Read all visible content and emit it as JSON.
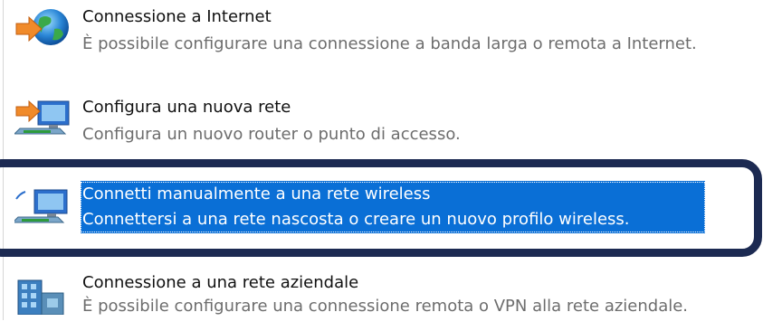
{
  "options": [
    {
      "title": "Connessione a Internet",
      "desc": "È possibile configurare una connessione a banda larga o remota a Internet.",
      "icon": "globe-arrow-icon",
      "selected": false
    },
    {
      "title": "Configura una nuova rete",
      "desc": "Configura un nuovo router o punto di accesso.",
      "icon": "router-setup-icon",
      "selected": false
    },
    {
      "title": "Connetti manualmente a una rete wireless",
      "desc": "Connettersi a una rete nascosta o creare un nuovo profilo wireless.",
      "icon": "wireless-network-icon",
      "selected": true
    },
    {
      "title": "Connessione a una rete aziendale",
      "desc": "È possibile configurare una connessione remota o VPN alla rete aziendale.",
      "icon": "workplace-building-icon",
      "selected": false
    }
  ],
  "colors": {
    "selection": "#0a6fd6",
    "focus_outline": "#1c2a52",
    "desc_text": "#6d6d6d"
  }
}
